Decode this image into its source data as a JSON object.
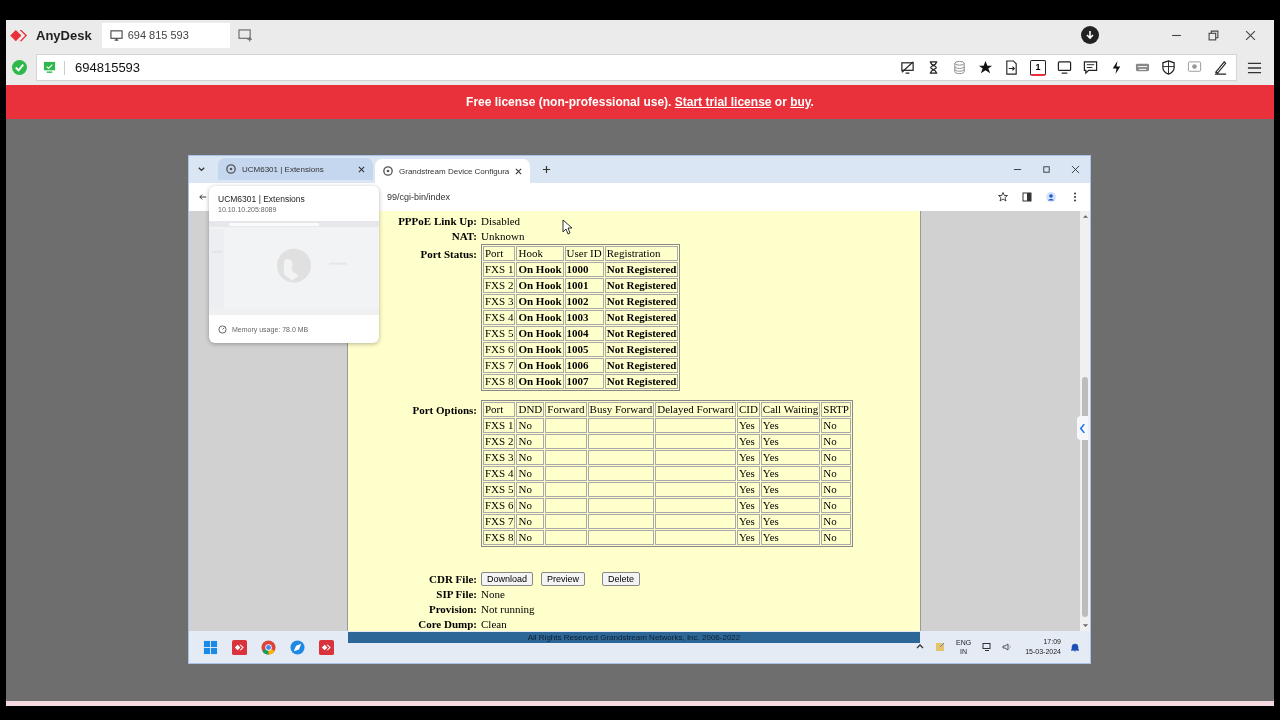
{
  "anydesk": {
    "app_name": "AnyDesk",
    "session_tab": "694 815 593",
    "address": "694815593",
    "display_number": "1",
    "banner": {
      "lead": "Free license (non-professional use).",
      "trial_link": "Start trial license",
      "joiner": "or",
      "buy_link": "buy",
      "tail": "."
    }
  },
  "browser": {
    "tabs": [
      {
        "title": "UCM6301 | Extensions",
        "selected": false
      },
      {
        "title": "Grandstream Device Configura",
        "selected": true
      }
    ],
    "address": "99/cgi-bin/index",
    "hover_card": {
      "title": "UCM6301 | Extensions",
      "url": "10.10.10.205:8089",
      "memory": "Memory usage: 78.0 MB"
    }
  },
  "status": {
    "top_fields": [
      {
        "label": "PPPoE Link Up:",
        "value": "Disabled"
      },
      {
        "label": "NAT:",
        "value": "Unknown"
      }
    ],
    "port_status": {
      "label": "Port Status:",
      "columns": [
        "Port",
        "Hook",
        "User ID",
        "Registration"
      ],
      "rows": [
        {
          "port": "FXS 1",
          "hook": "On Hook",
          "user_id": "1000",
          "registration": "Not Registered"
        },
        {
          "port": "FXS 2",
          "hook": "On Hook",
          "user_id": "1001",
          "registration": "Not Registered"
        },
        {
          "port": "FXS 3",
          "hook": "On Hook",
          "user_id": "1002",
          "registration": "Not Registered"
        },
        {
          "port": "FXS 4",
          "hook": "On Hook",
          "user_id": "1003",
          "registration": "Not Registered"
        },
        {
          "port": "FXS 5",
          "hook": "On Hook",
          "user_id": "1004",
          "registration": "Not Registered"
        },
        {
          "port": "FXS 6",
          "hook": "On Hook",
          "user_id": "1005",
          "registration": "Not Registered"
        },
        {
          "port": "FXS 7",
          "hook": "On Hook",
          "user_id": "1006",
          "registration": "Not Registered"
        },
        {
          "port": "FXS 8",
          "hook": "On Hook",
          "user_id": "1007",
          "registration": "Not Registered"
        }
      ]
    },
    "port_options": {
      "label": "Port Options:",
      "columns": [
        "Port",
        "DND",
        "Forward",
        "Busy Forward",
        "Delayed Forward",
        "CID",
        "Call Waiting",
        "SRTP"
      ],
      "rows": [
        {
          "port": "FXS 1",
          "dnd": "No",
          "cid": "Yes",
          "call_waiting": "Yes",
          "srtp": "No"
        },
        {
          "port": "FXS 2",
          "dnd": "No",
          "cid": "Yes",
          "call_waiting": "Yes",
          "srtp": "No"
        },
        {
          "port": "FXS 3",
          "dnd": "No",
          "cid": "Yes",
          "call_waiting": "Yes",
          "srtp": "No"
        },
        {
          "port": "FXS 4",
          "dnd": "No",
          "cid": "Yes",
          "call_waiting": "Yes",
          "srtp": "No"
        },
        {
          "port": "FXS 5",
          "dnd": "No",
          "cid": "Yes",
          "call_waiting": "Yes",
          "srtp": "No"
        },
        {
          "port": "FXS 6",
          "dnd": "No",
          "cid": "Yes",
          "call_waiting": "Yes",
          "srtp": "No"
        },
        {
          "port": "FXS 7",
          "dnd": "No",
          "cid": "Yes",
          "call_waiting": "Yes",
          "srtp": "No"
        },
        {
          "port": "FXS 8",
          "dnd": "No",
          "cid": "Yes",
          "call_waiting": "Yes",
          "srtp": "No"
        }
      ]
    },
    "cdr": {
      "label": "CDR File:",
      "buttons": [
        "Download",
        "Preview",
        "Delete"
      ]
    },
    "bottom_fields": [
      {
        "label": "SIP File:",
        "value": "None"
      },
      {
        "label": "Provision:",
        "value": "Not running"
      },
      {
        "label": "Core Dump:",
        "value": "Clean"
      }
    ],
    "footer": "All Rights Reserved Grandstream Networks, Inc. 2006-2022"
  },
  "taskbar": {
    "language": "ENG",
    "region": "IN",
    "time": "17:09",
    "date": "15-03-2024"
  }
}
